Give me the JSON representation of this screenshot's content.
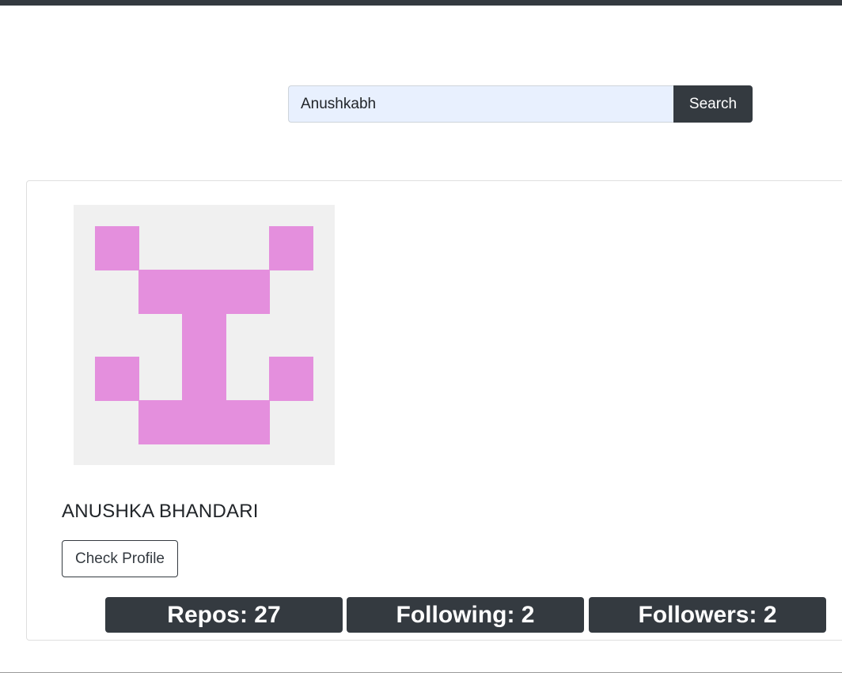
{
  "search": {
    "value": "Anushkabh",
    "button_label": "Search"
  },
  "profile": {
    "name": "ANUSHKA BHANDARI",
    "check_profile_label": "Check Profile",
    "avatar_color": "#e48fdd",
    "avatar_background": "#f0f0f0"
  },
  "stats": {
    "repos": "Repos: 27",
    "following": "Following: 2",
    "followers": "Followers: 2"
  },
  "colors": {
    "dark": "#343a40",
    "input_background": "#e8f0fe"
  }
}
